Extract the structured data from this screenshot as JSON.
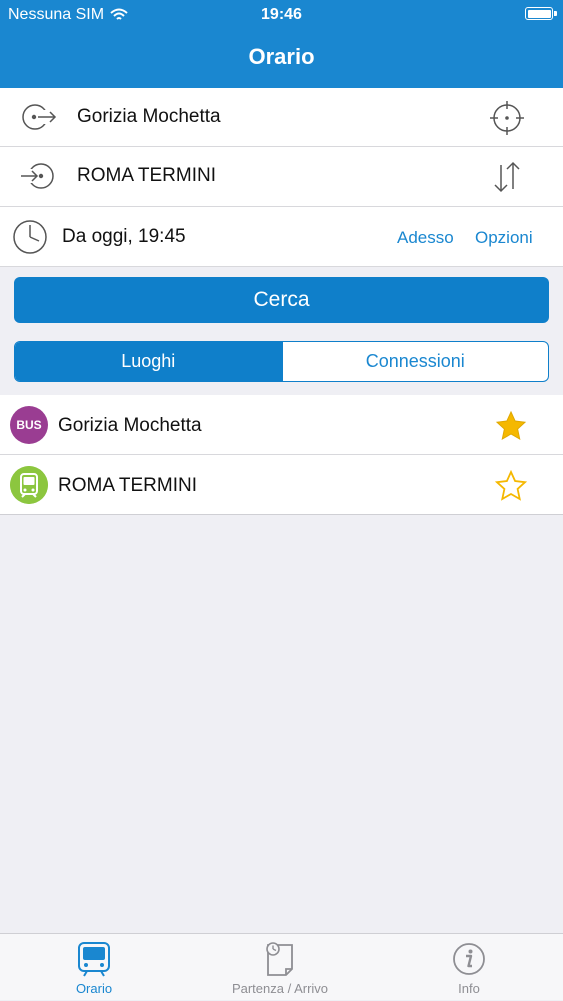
{
  "status_bar": {
    "carrier": "Nessuna SIM",
    "time": "19:46"
  },
  "nav": {
    "title": "Orario"
  },
  "form": {
    "from": "Gorizia Mochetta",
    "to": "ROMA TERMINI",
    "date": "Da oggi, 19:45",
    "now_label": "Adesso",
    "options_label": "Opzioni"
  },
  "search_button": "Cerca",
  "segments": {
    "places": "Luoghi",
    "connections": "Connessioni"
  },
  "favorites": [
    {
      "badge": "BUS",
      "label": "Gorizia Mochetta",
      "starred": true
    },
    {
      "badge": "",
      "label": "ROMA TERMINI",
      "starred": false
    }
  ],
  "tabbar": {
    "schedule": "Orario",
    "departure_arrival": "Partenza / Arrivo",
    "info": "Info"
  },
  "colors": {
    "accent": "#1a87d0",
    "bus_badge": "#9a3d92",
    "train_badge": "#8cc63f",
    "star": "#f5b800"
  }
}
